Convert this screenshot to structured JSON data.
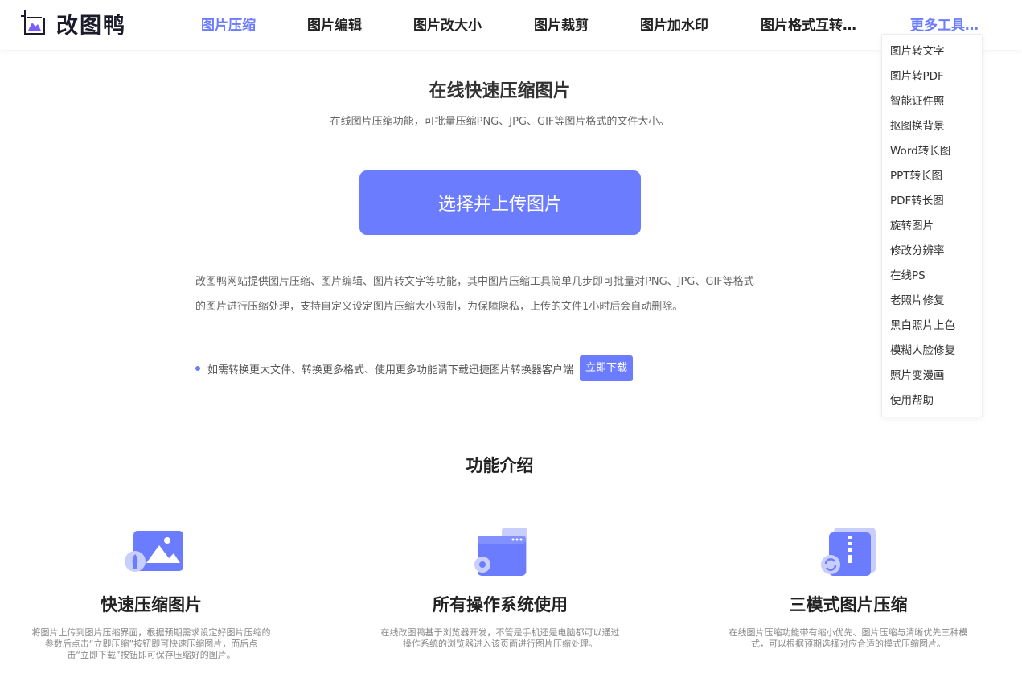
{
  "header": {
    "logo_text": "改图鸭",
    "nav": [
      {
        "label": "图片压缩",
        "active": true
      },
      {
        "label": "图片编辑"
      },
      {
        "label": "图片改大小"
      },
      {
        "label": "图片裁剪"
      },
      {
        "label": "图片加水印"
      },
      {
        "label": "图片格式互转…"
      },
      {
        "label": "更多工具…"
      }
    ]
  },
  "dropdown": {
    "items": [
      "图片转文字",
      "图片转PDF",
      "智能证件照",
      "抠图换背景",
      "Word转长图",
      "PPT转长图",
      "PDF转长图",
      "旋转图片",
      "修改分辨率",
      "在线PS",
      "老照片修复",
      "黑白照片上色",
      "模糊人脸修复",
      "照片变漫画",
      "使用帮助"
    ]
  },
  "main": {
    "title": "在线快速压缩图片",
    "subtitle": "在线图片压缩功能，可批量压缩PNG、JPG、GIF等图片格式的文件大小。",
    "upload_label": "选择并上传图片",
    "description_line1": "改图鸭网站提供图片压缩、图片编辑、图片转文字等功能，其中图片压缩工具简单几步即可批量对PNG、JPG、GIF等格式",
    "description_line2": "的图片进行压缩处理，支持自定义设定图片压缩大小限制，为保障隐私，上传的文件1小时后会自动删除。",
    "tip_text": "如需转换更大文件、转换更多格式、使用更多功能请下载迅捷图片转换器客户端",
    "tip_button": "立即下载"
  },
  "features": {
    "section_title": "功能介绍",
    "items": [
      {
        "title": "快速压缩图片",
        "desc_line1": "将图片上传到图片压缩界面，根据预期需求设定好图片压缩的",
        "desc_line2": "参数后点击“立即压缩”按钮即可快速压缩图片，而后点",
        "desc_line3": "击“立即下载”按钮即可保存压缩好的图片。",
        "icon": "image-rocket-icon"
      },
      {
        "title": "所有操作系统使用",
        "desc_line1": "在线改图鸭基于浏览器开发，不管是手机还是电脑都可以通过",
        "desc_line2": "操作系统的浏览器进入该页面进行图片压缩处理。",
        "desc_line3": "",
        "icon": "browser-gear-icon"
      },
      {
        "title": "三模式图片压缩",
        "desc_line1": "在线图片压缩功能带有缩小优先、图片压缩与清晰优先三种模",
        "desc_line2": "式，可以根据预期选择对应合适的模式压缩图片。",
        "desc_line3": "",
        "icon": "zip-refresh-icon"
      }
    ]
  },
  "colors": {
    "accent": "#6b7cff",
    "accent_light": "#c9cffd"
  }
}
